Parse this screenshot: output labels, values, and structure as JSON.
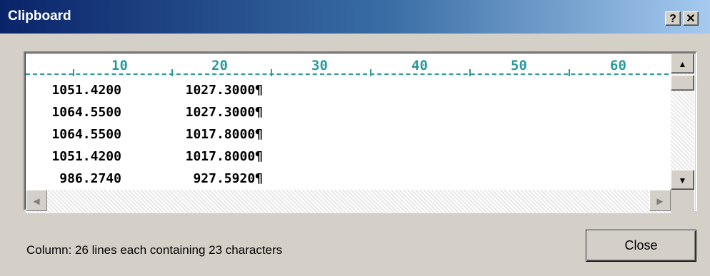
{
  "window": {
    "title": "Clipboard"
  },
  "titlebar_buttons": {
    "help": "?",
    "close": "✕"
  },
  "ruler": {
    "marks": [
      "10",
      "20",
      "30",
      "40",
      "50",
      "60"
    ]
  },
  "rows": [
    [
      "1051.4200",
      "1027.3000¶"
    ],
    [
      "1064.5500",
      "1027.3000¶"
    ],
    [
      "1064.5500",
      "1017.8000¶"
    ],
    [
      "1051.4200",
      "1017.8000¶"
    ],
    [
      " 986.2740",
      " 927.5920¶"
    ]
  ],
  "scrollbar": {
    "up": "▲",
    "down": "▼",
    "left": "◀",
    "right": "▶"
  },
  "status_text": "Column: 26 lines each containing 23 characters",
  "close_label": "Close"
}
